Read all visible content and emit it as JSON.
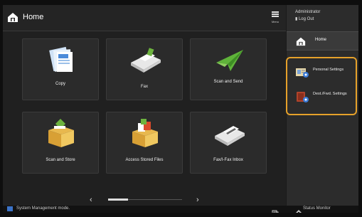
{
  "header": {
    "title": "Home",
    "menu_label": "Menu"
  },
  "side": {
    "user": "Administrator",
    "logout": "Log Out",
    "home": "Home",
    "shortcuts": [
      {
        "label": "Personal Settings"
      },
      {
        "label": "Dest./Fwd. Settings"
      }
    ]
  },
  "tiles": [
    {
      "label": "Copy",
      "icon": "copy-icon"
    },
    {
      "label": "Fax",
      "icon": "fax-icon"
    },
    {
      "label": "Scan and Send",
      "icon": "scan-send-icon"
    },
    {
      "label": "Scan and Store",
      "icon": "scan-store-icon"
    },
    {
      "label": "Access Stored Files",
      "icon": "access-files-icon"
    },
    {
      "label": "Fax/I-Fax Inbox",
      "icon": "fax-inbox-icon"
    }
  ],
  "status": {
    "message": "System Management mode.",
    "monitor": "Status Monitor"
  },
  "colors": {
    "highlight": "#e6a12a"
  }
}
